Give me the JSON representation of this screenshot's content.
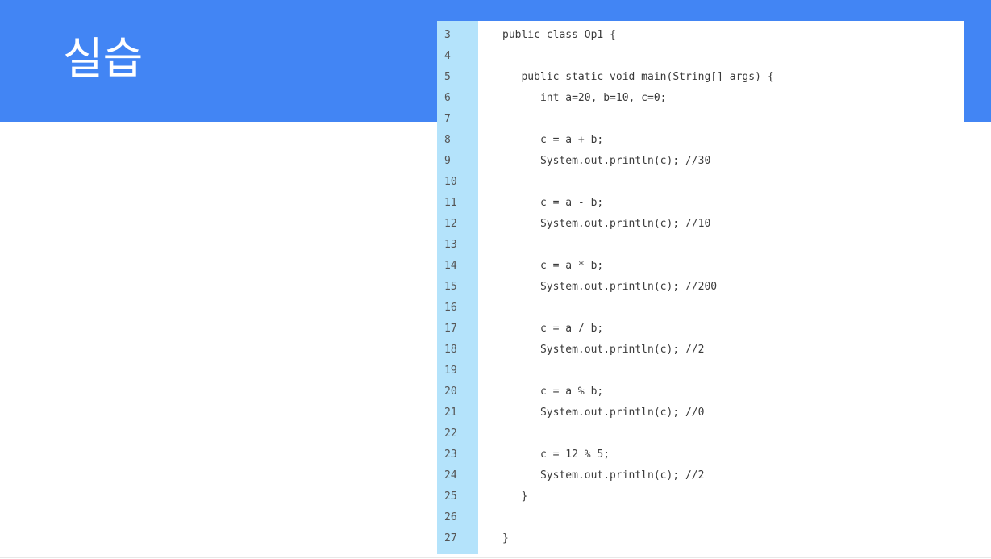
{
  "slide": {
    "title": "실습"
  },
  "colors": {
    "header": "#4285f4",
    "gutter": "#b4e3fb"
  },
  "code": {
    "lines": [
      {
        "no": "3",
        "text": "public class Op1 {"
      },
      {
        "no": "4",
        "text": ""
      },
      {
        "no": "5",
        "text": "   public static void main(String[] args) {"
      },
      {
        "no": "6",
        "text": "      int a=20, b=10, c=0;"
      },
      {
        "no": "7",
        "text": ""
      },
      {
        "no": "8",
        "text": "      c = a + b;"
      },
      {
        "no": "9",
        "text": "      System.out.println(c); //30"
      },
      {
        "no": "10",
        "text": ""
      },
      {
        "no": "11",
        "text": "      c = a - b;"
      },
      {
        "no": "12",
        "text": "      System.out.println(c); //10"
      },
      {
        "no": "13",
        "text": ""
      },
      {
        "no": "14",
        "text": "      c = a * b;"
      },
      {
        "no": "15",
        "text": "      System.out.println(c); //200"
      },
      {
        "no": "16",
        "text": ""
      },
      {
        "no": "17",
        "text": "      c = a / b;"
      },
      {
        "no": "18",
        "text": "      System.out.println(c); //2"
      },
      {
        "no": "19",
        "text": ""
      },
      {
        "no": "20",
        "text": "      c = a % b;"
      },
      {
        "no": "21",
        "text": "      System.out.println(c); //0"
      },
      {
        "no": "22",
        "text": ""
      },
      {
        "no": "23",
        "text": "      c = 12 % 5;"
      },
      {
        "no": "24",
        "text": "      System.out.println(c); //2"
      },
      {
        "no": "25",
        "text": "   }"
      },
      {
        "no": "26",
        "text": ""
      },
      {
        "no": "27",
        "text": "}"
      }
    ]
  }
}
